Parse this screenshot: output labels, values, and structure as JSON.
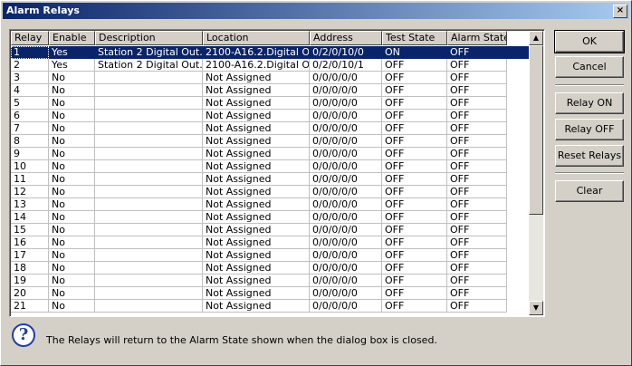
{
  "window": {
    "title": "Alarm Relays",
    "close_glyph": "×"
  },
  "table": {
    "columns": [
      "Relay",
      "Enable",
      "Description",
      "Location",
      "Address",
      "Test State",
      "Alarm State"
    ],
    "rows": [
      [
        "1",
        "Yes",
        "Station 2 Digital Out...",
        "2100-A16.2.Digital O...",
        "0/2/0/10/0",
        "ON",
        "OFF"
      ],
      [
        "2",
        "Yes",
        "Station 2 Digital Out...",
        "2100-A16.2.Digital O...",
        "0/2/0/10/1",
        "OFF",
        "OFF"
      ],
      [
        "3",
        "No",
        "",
        "Not Assigned",
        "0/0/0/0/0",
        "OFF",
        "OFF"
      ],
      [
        "4",
        "No",
        "",
        "Not Assigned",
        "0/0/0/0/0",
        "OFF",
        "OFF"
      ],
      [
        "5",
        "No",
        "",
        "Not Assigned",
        "0/0/0/0/0",
        "OFF",
        "OFF"
      ],
      [
        "6",
        "No",
        "",
        "Not Assigned",
        "0/0/0/0/0",
        "OFF",
        "OFF"
      ],
      [
        "7",
        "No",
        "",
        "Not Assigned",
        "0/0/0/0/0",
        "OFF",
        "OFF"
      ],
      [
        "8",
        "No",
        "",
        "Not Assigned",
        "0/0/0/0/0",
        "OFF",
        "OFF"
      ],
      [
        "9",
        "No",
        "",
        "Not Assigned",
        "0/0/0/0/0",
        "OFF",
        "OFF"
      ],
      [
        "10",
        "No",
        "",
        "Not Assigned",
        "0/0/0/0/0",
        "OFF",
        "OFF"
      ],
      [
        "11",
        "No",
        "",
        "Not Assigned",
        "0/0/0/0/0",
        "OFF",
        "OFF"
      ],
      [
        "12",
        "No",
        "",
        "Not Assigned",
        "0/0/0/0/0",
        "OFF",
        "OFF"
      ],
      [
        "13",
        "No",
        "",
        "Not Assigned",
        "0/0/0/0/0",
        "OFF",
        "OFF"
      ],
      [
        "14",
        "No",
        "",
        "Not Assigned",
        "0/0/0/0/0",
        "OFF",
        "OFF"
      ],
      [
        "15",
        "No",
        "",
        "Not Assigned",
        "0/0/0/0/0",
        "OFF",
        "OFF"
      ],
      [
        "16",
        "No",
        "",
        "Not Assigned",
        "0/0/0/0/0",
        "OFF",
        "OFF"
      ],
      [
        "17",
        "No",
        "",
        "Not Assigned",
        "0/0/0/0/0",
        "OFF",
        "OFF"
      ],
      [
        "18",
        "No",
        "",
        "Not Assigned",
        "0/0/0/0/0",
        "OFF",
        "OFF"
      ],
      [
        "19",
        "No",
        "",
        "Not Assigned",
        "0/0/0/0/0",
        "OFF",
        "OFF"
      ],
      [
        "20",
        "No",
        "",
        "Not Assigned",
        "0/0/0/0/0",
        "OFF",
        "OFF"
      ],
      [
        "21",
        "No",
        "",
        "Not Assigned",
        "0/0/0/0/0",
        "OFF",
        "OFF"
      ]
    ],
    "selected_row": 1
  },
  "buttons": {
    "ok": "OK",
    "cancel": "Cancel",
    "relay_on": "Relay ON",
    "relay_off": "Relay OFF",
    "reset_relays": "Reset Relays",
    "clear": "Clear"
  },
  "scrollbar": {
    "up_glyph": "▲",
    "down_glyph": "▼"
  },
  "info": {
    "icon": "question-icon",
    "icon_glyph": "?",
    "message": "The Relays will return to the Alarm State shown when the dialog box is closed."
  },
  "colors": {
    "selection": "#0a246a",
    "title_start": "#0a246a",
    "title_end": "#a6caf0"
  }
}
